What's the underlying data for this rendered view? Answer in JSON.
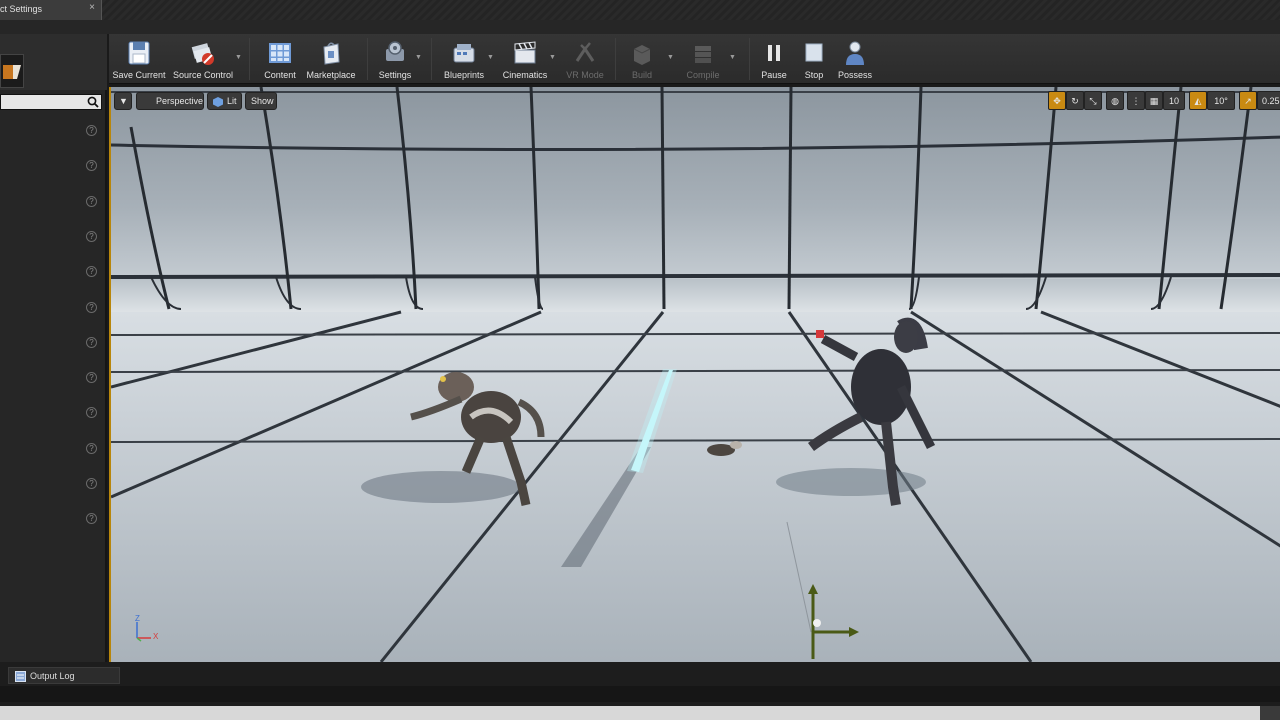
{
  "window": {
    "tab_title": "ct Settings",
    "tab_close": "×"
  },
  "toolbar": {
    "buttons": [
      {
        "id": "save_current",
        "label": "Save Current",
        "icon": "save-icon"
      },
      {
        "id": "source_control",
        "label": "Source Control",
        "icon": "source-control-icon"
      },
      {
        "id": "content",
        "label": "Content",
        "icon": "content-browser-icon"
      },
      {
        "id": "marketplace",
        "label": "Marketplace",
        "icon": "marketplace-icon"
      },
      {
        "id": "settings",
        "label": "Settings",
        "icon": "settings-icon"
      },
      {
        "id": "blueprints",
        "label": "Blueprints",
        "icon": "blueprints-icon"
      },
      {
        "id": "cinematics",
        "label": "Cinematics",
        "icon": "clapperboard-icon"
      },
      {
        "id": "vr_mode",
        "label": "VR Mode",
        "icon": "vr-headset-icon",
        "disabled": true
      },
      {
        "id": "build",
        "label": "Build",
        "icon": "build-icon",
        "disabled": true
      },
      {
        "id": "compile",
        "label": "Compile",
        "icon": "compile-icon",
        "disabled": true
      },
      {
        "id": "pause",
        "label": "Pause",
        "icon": "pause-icon"
      },
      {
        "id": "stop",
        "label": "Stop",
        "icon": "stop-icon"
      },
      {
        "id": "possess",
        "label": "Possess",
        "icon": "possess-icon"
      }
    ],
    "dropdown_arrow": "▼"
  },
  "viewport": {
    "menu_arrow": "▼",
    "perspective_label": "Perspective",
    "lit_label": "Lit",
    "show_label": "Show",
    "grid_snap_value": "10",
    "rotation_snap_value": "10°",
    "scale_snap_value": "0.25",
    "axis": {
      "z": "Z",
      "x": "X"
    }
  },
  "left_panel": {
    "help_glyph": "?",
    "help_count": 12
  },
  "bottom": {
    "output_log_label": "Output Log"
  },
  "colors": {
    "accent_orange": "#c98a12",
    "toolbar_bg": "#2f2f2f",
    "panel_bg": "#262626"
  }
}
